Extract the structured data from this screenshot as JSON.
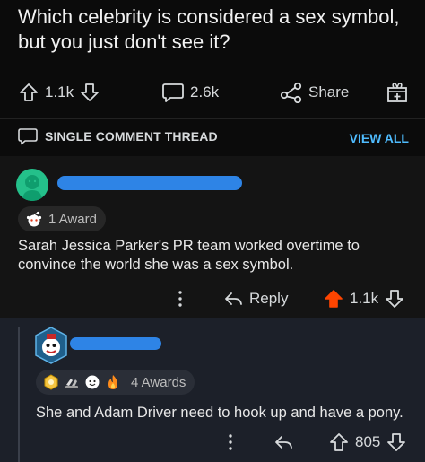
{
  "post": {
    "title": "Which celebrity is considered a sex symbol, but you just don't see it?",
    "score": "1.1k",
    "comments": "2.6k",
    "share_label": "Share"
  },
  "thread": {
    "label": "SINGLE COMMENT THREAD",
    "view_all": "VIEW ALL"
  },
  "comment1": {
    "awards": "1 Award",
    "body": "Sarah Jessica Parker's PR team worked overtime to convince the world she was a sex symbol.",
    "reply_label": "Reply",
    "score": "1.1k"
  },
  "comment2": {
    "awards": "4 Awards",
    "body": "She and Adam Driver need to hook up and have a pony.",
    "score": "805"
  },
  "colors": {
    "upvote_active": "#ff4500",
    "link": "#4fbcff",
    "redaction": "#2e84e6"
  }
}
